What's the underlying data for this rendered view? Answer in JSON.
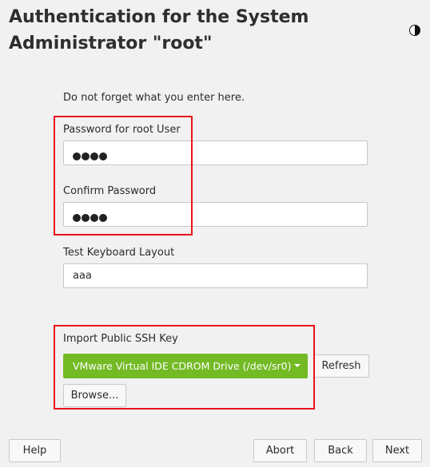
{
  "title": "Authentication for the System Administrator \"root\"",
  "theme_icon": "half-moon-icon",
  "hint": "Do not forget what you enter here.",
  "password": {
    "label": "Password for root User",
    "value_masked": "●●●●"
  },
  "confirm": {
    "label": "Confirm Password",
    "value_masked": "●●●●"
  },
  "keyboard": {
    "label": "Test Keyboard Layout",
    "value": "aaa"
  },
  "ssh": {
    "label": "Import Public SSH Key",
    "selected": "VMware Virtual IDE CDROM Drive (/dev/sr0)",
    "refresh": "Refresh",
    "browse": "Browse..."
  },
  "footer": {
    "help": "Help",
    "abort": "Abort",
    "back": "Back",
    "next": "Next"
  },
  "colors": {
    "accent": "#73ba25",
    "highlight": "#e8131b"
  }
}
